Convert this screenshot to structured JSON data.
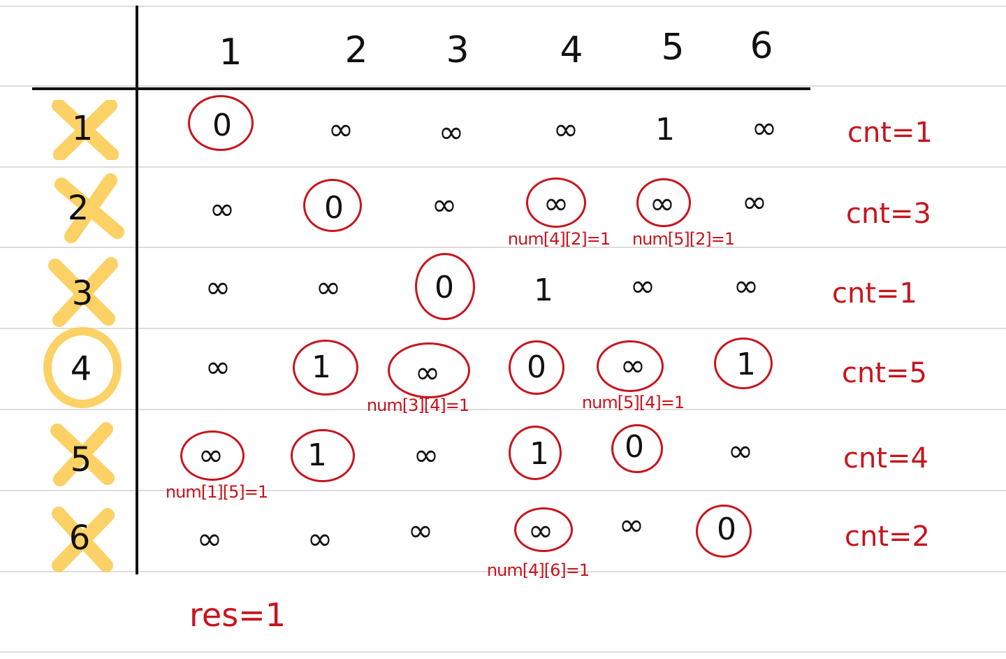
{
  "columns": [
    "1",
    "2",
    "3",
    "4",
    "5",
    "6"
  ],
  "rows": [
    {
      "label": "1",
      "crossed": true,
      "circled": false,
      "cells": [
        "0",
        "∞",
        "∞",
        "∞",
        "1",
        "∞"
      ],
      "cnt": "cnt=1"
    },
    {
      "label": "2",
      "crossed": true,
      "circled": false,
      "cells": [
        "∞",
        "0",
        "∞",
        "∞",
        "∞",
        "∞"
      ],
      "cnt": "cnt=3"
    },
    {
      "label": "3",
      "crossed": true,
      "circled": false,
      "cells": [
        "∞",
        "∞",
        "0",
        "1",
        "∞",
        "∞"
      ],
      "cnt": "cnt=1"
    },
    {
      "label": "4",
      "crossed": false,
      "circled": true,
      "cells": [
        "∞",
        "1",
        "∞",
        "0",
        "∞",
        "1"
      ],
      "cnt": "cnt=5"
    },
    {
      "label": "5",
      "crossed": true,
      "circled": false,
      "cells": [
        "∞",
        "1",
        "∞",
        "1",
        "0",
        "∞"
      ],
      "cnt": "cnt=4"
    },
    {
      "label": "6",
      "crossed": true,
      "circled": false,
      "cells": [
        "∞",
        "∞",
        "∞",
        "∞",
        "∞",
        "0"
      ],
      "cnt": "cnt=2"
    }
  ],
  "annotations": [
    "num[4][2]=1",
    "num[5][2]=1",
    "num[3][4]=1",
    "num[5][4]=1",
    "num[1][5]=1",
    "num[4][6]=1"
  ],
  "result": "res=1",
  "colors": {
    "ink": "#111111",
    "red_ink": "#c8141c",
    "highlighter": "#fcc94a",
    "ruled_line": "#dcdcdc"
  }
}
